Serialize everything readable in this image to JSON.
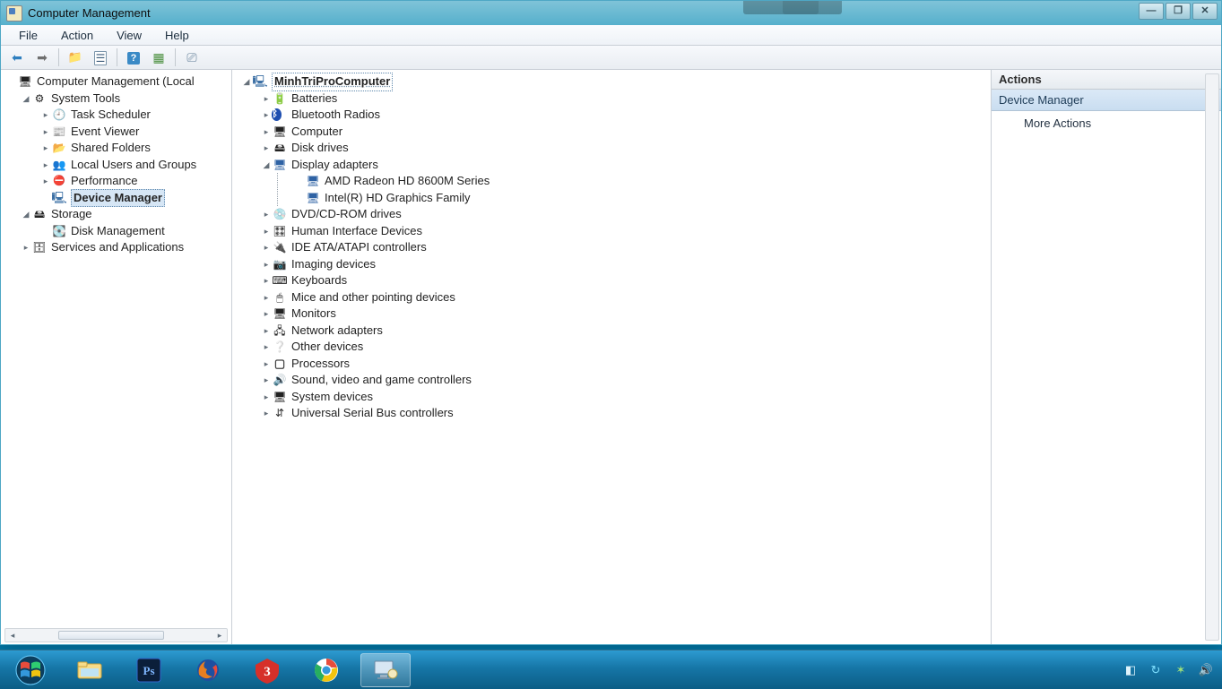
{
  "window": {
    "title": "Computer Management"
  },
  "title_buttons": {
    "min": "—",
    "max": "❐",
    "close": "✕"
  },
  "menu": {
    "file": "File",
    "action": "Action",
    "view": "View",
    "help": "Help"
  },
  "left_tree": {
    "root": "Computer Management (Local",
    "system_tools": "System Tools",
    "task_scheduler": "Task Scheduler",
    "event_viewer": "Event Viewer",
    "shared_folders": "Shared Folders",
    "local_users": "Local Users and Groups",
    "performance": "Performance",
    "device_manager": "Device Manager",
    "storage": "Storage",
    "disk_management": "Disk Management",
    "services_apps": "Services and Applications"
  },
  "mid_tree": {
    "root": "MinhTriProComputer",
    "batteries": "Batteries",
    "bluetooth": "Bluetooth Radios",
    "computer": "Computer",
    "disk_drives": "Disk drives",
    "display_adapters": "Display adapters",
    "display_child_1": "AMD Radeon HD 8600M Series",
    "display_child_2": "Intel(R) HD Graphics Family",
    "dvd": "DVD/CD-ROM drives",
    "hid": "Human Interface Devices",
    "ide": "IDE ATA/ATAPI controllers",
    "imaging": "Imaging devices",
    "keyboards": "Keyboards",
    "mice": "Mice and other pointing devices",
    "monitors": "Monitors",
    "network": "Network adapters",
    "other": "Other devices",
    "processors": "Processors",
    "sound": "Sound, video and game controllers",
    "system_devices": "System devices",
    "usb": "Universal Serial Bus controllers"
  },
  "actions": {
    "header": "Actions",
    "section": "Device Manager",
    "more": "More Actions"
  },
  "taskbar": {
    "apps": [
      "start",
      "explorer",
      "photoshop",
      "firefox",
      "n3",
      "chrome",
      "compmgmt"
    ]
  }
}
